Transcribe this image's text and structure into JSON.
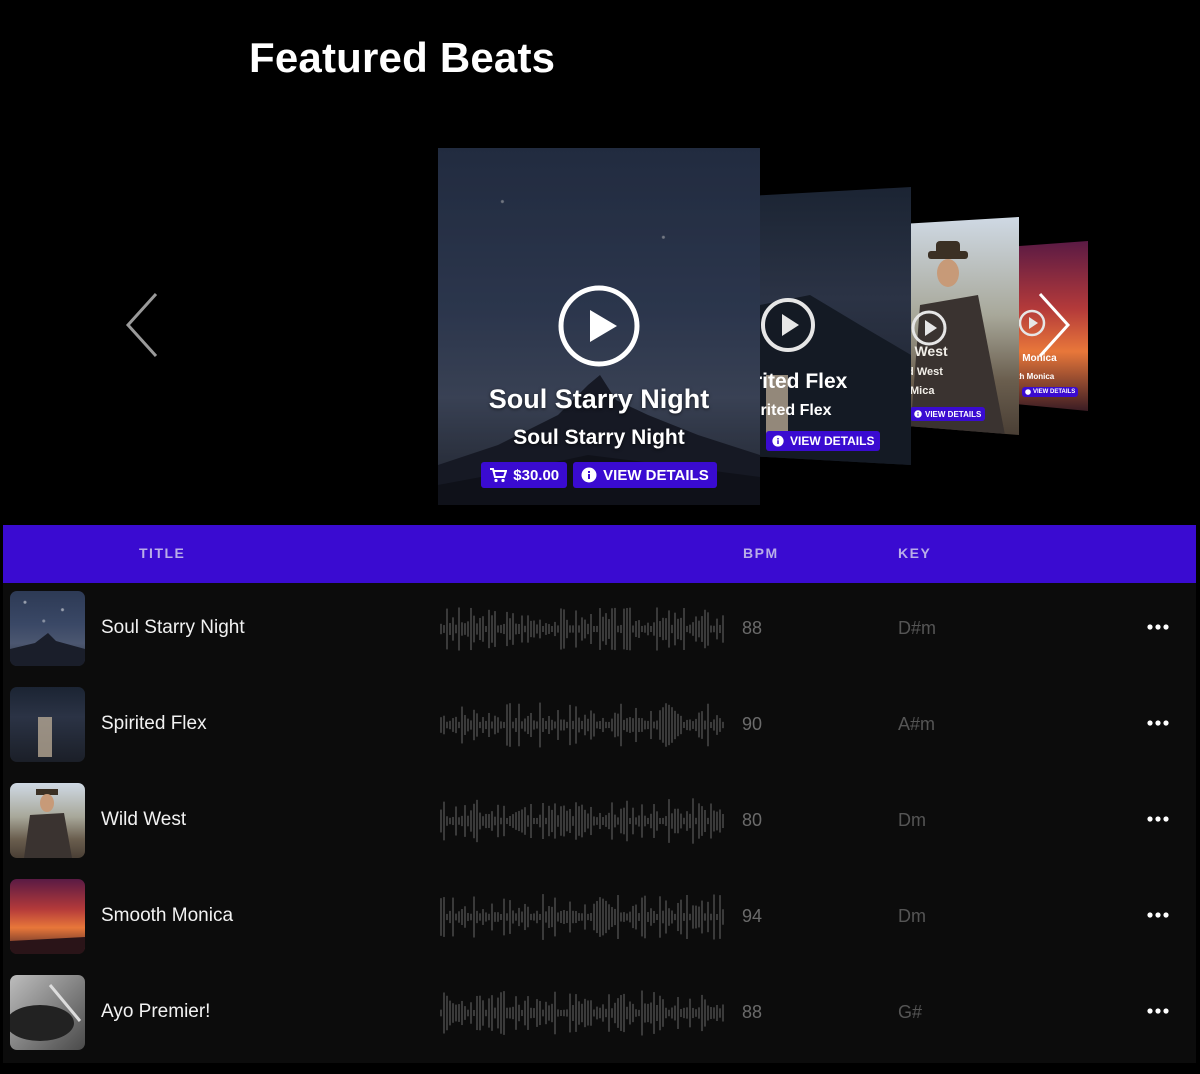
{
  "page": {
    "title": "Featured Beats"
  },
  "carousel": {
    "main": {
      "title": "Soul Starry Night",
      "subtitle": "Soul Starry Night",
      "price_label": "$30.00",
      "details_label": "VIEW DETAILS"
    },
    "second": {
      "title": "rited Flex",
      "subtitle": "irited Flex",
      "details_label": "VIEW DETAILS"
    },
    "third": {
      "title": "d West",
      "subtitle": "ld West",
      "artist": "Mica",
      "details_label": "VIEW DETAILS"
    },
    "fourth": {
      "title": "th Monica",
      "subtitle": "oth Monica",
      "details_label": "VIEW DETAILS"
    },
    "icons": {
      "prev": "chevron-left-icon",
      "next": "chevron-right-icon",
      "play": "play-circle-icon",
      "cart": "cart-icon",
      "info": "info-icon"
    }
  },
  "table": {
    "headers": {
      "title": "TITLE",
      "bpm": "BPM",
      "key": "KEY"
    },
    "rows": [
      {
        "title": "Soul Starry Night",
        "bpm": "88",
        "key": "D#m"
      },
      {
        "title": "Spirited Flex",
        "bpm": "90",
        "key": "A#m"
      },
      {
        "title": "Wild West",
        "bpm": "80",
        "key": "Dm"
      },
      {
        "title": "Smooth Monica",
        "bpm": "94",
        "key": "Dm"
      },
      {
        "title": "Ayo Premier!",
        "bpm": "88",
        "key": "G#"
      }
    ]
  },
  "colors": {
    "accent": "#3a0bd1",
    "background": "#000000",
    "row_background": "#0c0c0c"
  }
}
